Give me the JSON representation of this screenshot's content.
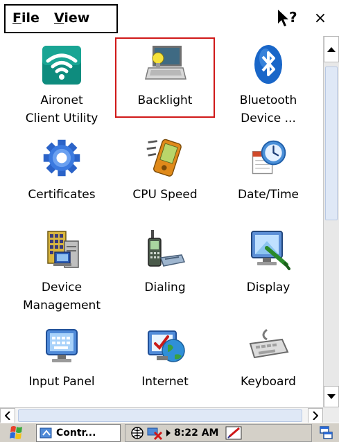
{
  "menu": {
    "file_hotkey": "F",
    "file_rest": "ile",
    "view_hotkey": "V",
    "view_rest": "iew"
  },
  "titlebar": {
    "close_glyph": "×"
  },
  "items": [
    {
      "label": "Aironet\nClient Utility",
      "icon": "wifi-icon"
    },
    {
      "label": "Backlight",
      "icon": "backlight-laptop-icon",
      "selected": true
    },
    {
      "label": "Bluetooth\nDevice ...",
      "icon": "bluetooth-icon"
    },
    {
      "label": "Certificates",
      "icon": "certificates-gear-icon"
    },
    {
      "label": "CPU Speed",
      "icon": "cpu-speed-pda-icon"
    },
    {
      "label": "Date/Time",
      "icon": "date-time-clock-icon"
    },
    {
      "label": "Device\nManagement",
      "icon": "device-management-icon"
    },
    {
      "label": "Dialing",
      "icon": "dialing-phone-icon"
    },
    {
      "label": "Display",
      "icon": "display-monitor-icon"
    },
    {
      "label": "Input Panel",
      "icon": "input-panel-icon"
    },
    {
      "label": "Internet",
      "icon": "internet-globe-icon"
    },
    {
      "label": "Keyboard",
      "icon": "keyboard-icon"
    }
  ],
  "taskbar": {
    "task_label": "Contr...",
    "clock": "8:22 AM"
  },
  "colors": {
    "selection_border": "#d01818",
    "scroll_thumb": "#dfe8f6",
    "taskbar": "#d4d0c8"
  }
}
